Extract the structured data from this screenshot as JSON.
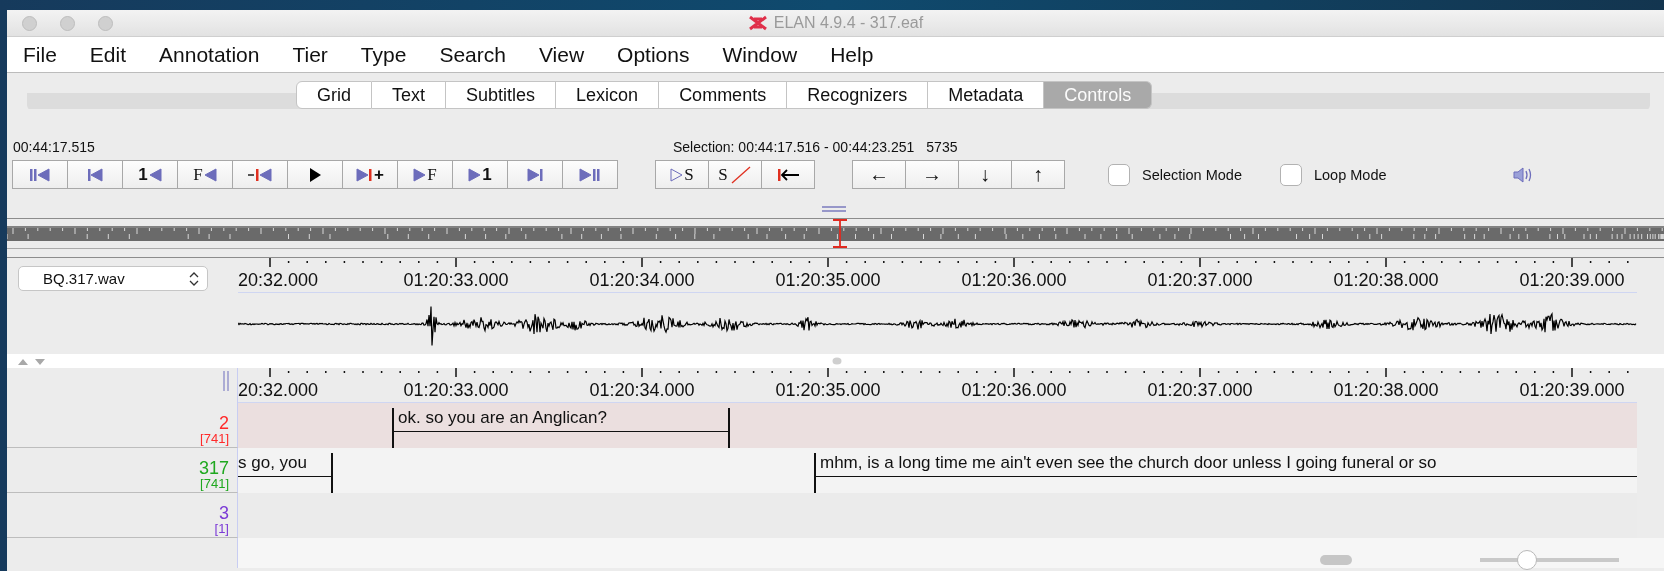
{
  "window": {
    "title": "ELAN 4.9.4 - 317.eaf"
  },
  "menu": [
    "File",
    "Edit",
    "Annotation",
    "Tier",
    "Type",
    "Search",
    "View",
    "Options",
    "Window",
    "Help"
  ],
  "tabs": [
    {
      "label": "Grid",
      "selected": false
    },
    {
      "label": "Text",
      "selected": false
    },
    {
      "label": "Subtitles",
      "selected": false
    },
    {
      "label": "Lexicon",
      "selected": false
    },
    {
      "label": "Comments",
      "selected": false
    },
    {
      "label": "Recognizers",
      "selected": false
    },
    {
      "label": "Metadata",
      "selected": false
    },
    {
      "label": "Controls",
      "selected": true
    }
  ],
  "player": {
    "time": "00:44:17.515",
    "selection": "Selection: 00:44:17.516 - 00:44:23.251",
    "selection_length": "5735",
    "buttons": [
      {
        "kind": "to-begin"
      },
      {
        "kind": "prev"
      },
      {
        "kind": "step-back",
        "label": "1"
      },
      {
        "kind": "step-back",
        "label": "F"
      },
      {
        "kind": "back-mark"
      },
      {
        "kind": "play"
      },
      {
        "kind": "forward-mark",
        "label": "+"
      },
      {
        "kind": "step-forward",
        "label": "F"
      },
      {
        "kind": "step-forward",
        "label": "1"
      },
      {
        "kind": "next"
      },
      {
        "kind": "to-end"
      }
    ],
    "selection_buttons": [
      {
        "kind": "play-selection",
        "label": "S"
      },
      {
        "kind": "clear-selection",
        "label": "S"
      },
      {
        "kind": "to-selection-begin"
      }
    ],
    "navigation_buttons": [
      {
        "kind": "text",
        "label": "←"
      },
      {
        "kind": "text",
        "label": "→"
      },
      {
        "kind": "text",
        "label": "↓"
      },
      {
        "kind": "text",
        "label": "↑"
      }
    ],
    "checkboxes": [
      {
        "label": "Selection Mode",
        "checked": false
      },
      {
        "label": "Loop Mode",
        "checked": false
      }
    ]
  },
  "media": {
    "file": "BQ.317.wav",
    "ruler_labels": [
      "20:32.000",
      "01:20:33.000",
      "01:20:34.000",
      "01:20:35.000",
      "01:20:36.000",
      "01:20:37.000",
      "01:20:38.000",
      "01:20:39.000"
    ]
  },
  "annotation_view": {
    "ruler_labels": [
      "20:32.000",
      "01:20:33.000",
      "01:20:34.000",
      "01:20:35.000",
      "01:20:36.000",
      "01:20:37.000",
      "01:20:38.000",
      "01:20:39.000"
    ],
    "tiers": [
      {
        "name": "2",
        "count": "[741]",
        "color": "#ff2a2a",
        "selected": true,
        "annotations": [
          {
            "text": "ok. so you are an Anglican?"
          }
        ]
      },
      {
        "name": "317",
        "count": "[741]",
        "color": "#1fa81f",
        "selected": false,
        "annotations": [
          {
            "text": "s go, you"
          },
          {
            "text": "mhm, is a long time me ain't even see the church door unless I going funeral or so"
          }
        ]
      },
      {
        "name": "3",
        "count": "[1]",
        "color": "#7b3ad6",
        "selected": false
      }
    ]
  },
  "zoom_slider": {
    "level": 0.34
  }
}
